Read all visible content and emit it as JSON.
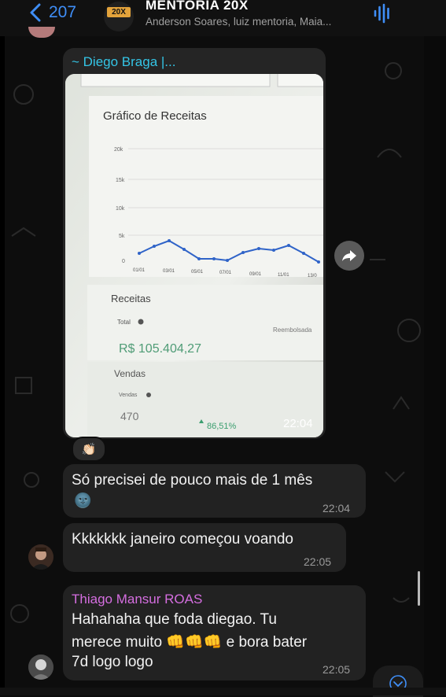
{
  "header": {
    "back_count": "207",
    "group_title": "MENTORIA 20X",
    "group_badge": "20X",
    "members": "Anderson Soares, luiz mentoria, Maia..."
  },
  "image_message": {
    "sender": "~ Diego Braga |...",
    "time": "22:04",
    "reaction": "👏🏻",
    "screenshot": {
      "chart_title": "Gráfico de Receitas",
      "y_ticks": [
        "20k",
        "15k",
        "10k",
        "5k",
        "0"
      ],
      "x_ticks": [
        "01/01",
        "03/01",
        "05/01",
        "07/01",
        "09/01",
        "11/01",
        "13/0"
      ],
      "receitas_label": "Receitas",
      "total_label": "Total",
      "total_value": "R$ 105.404,27",
      "reembolsado_label": "Reembolsada",
      "vendas_heading": "Vendas",
      "vendas_label": "Vendas",
      "vendas_value": "470",
      "vendas_change": "86,51%"
    }
  },
  "messages": [
    {
      "text": "Só precisei de pouco mais de 1 mês",
      "emoji": "🌚",
      "time": "22:04"
    },
    {
      "text": "Kkkkkkk janeiro começou voando",
      "time": "22:05"
    },
    {
      "sender": "Thiago Mansur ROAS",
      "line1": "Hahahaha que foda diegao. Tu",
      "line2": "merece muito 👊👊👊 e bora bater",
      "line3": "7d logo logo",
      "time": "22:05"
    }
  ],
  "colors": {
    "accent": "#3f8ef7",
    "diego": "#34c5e6",
    "thiago": "#d56ee0",
    "bubble": "#222222"
  }
}
